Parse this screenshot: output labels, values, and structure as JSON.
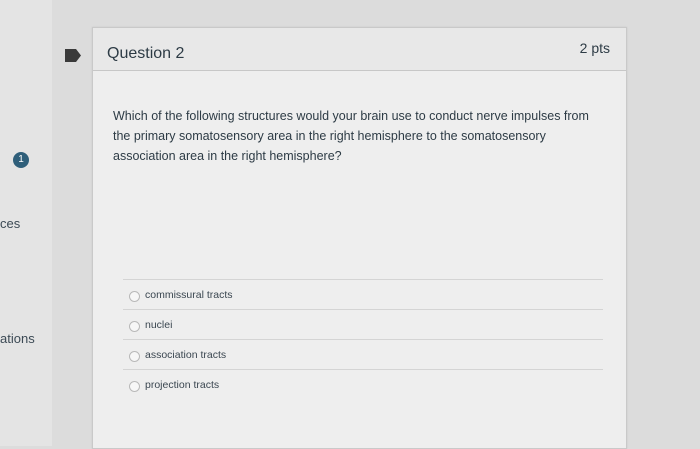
{
  "sidebar": {
    "badge": "1",
    "item_1_fragment": "ces",
    "item_2_fragment": "ations"
  },
  "question": {
    "title": "Question 2",
    "points": "2 pts",
    "text": "Which of the following structures would your brain use to conduct nerve impulses from the primary somatosensory area in the right hemisphere to the somatosensory association area in the right hemisphere?",
    "answers": [
      "commissural tracts",
      "nuclei",
      "association tracts",
      "projection tracts"
    ]
  },
  "icons": {
    "flag": "flag-icon"
  },
  "colors": {
    "badge": "#2f5f7a",
    "flag": "#3a3a3a"
  }
}
